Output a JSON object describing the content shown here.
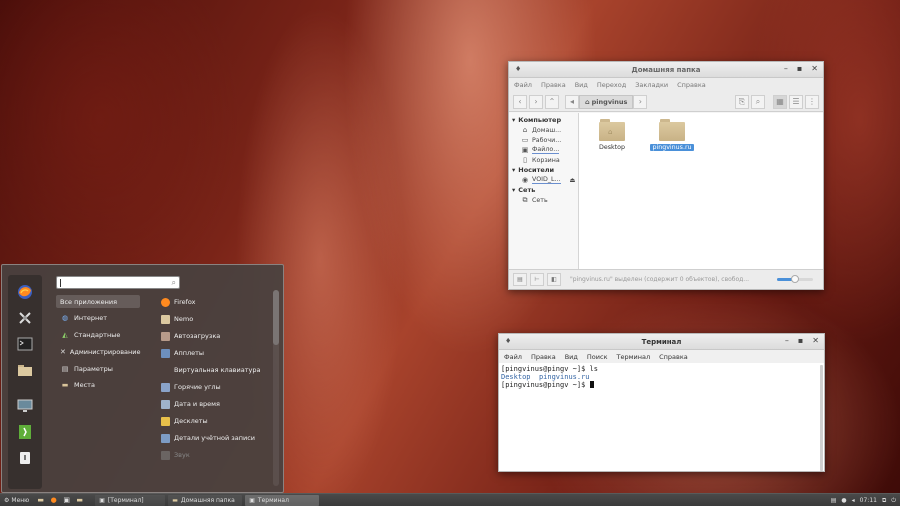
{
  "file_manager": {
    "title": "Домашняя папка",
    "menu": [
      "Файл",
      "Правка",
      "Вид",
      "Переход",
      "Закладки",
      "Справка"
    ],
    "path": "pingvinus",
    "sidebar": {
      "computer": {
        "header": "Компьютер",
        "items": [
          {
            "label": "Домаш...",
            "icon": "home-icon"
          },
          {
            "label": "Рабочи...",
            "icon": "desktop-icon"
          },
          {
            "label": "Файло...",
            "icon": "drive-icon"
          },
          {
            "label": "Корзина",
            "icon": "trash-icon"
          }
        ]
      },
      "devices": {
        "header": "Носители",
        "items": [
          {
            "label": "VOID_L...",
            "icon": "disc-icon"
          }
        ]
      },
      "network": {
        "header": "Сеть",
        "items": [
          {
            "label": "Сеть",
            "icon": "network-icon"
          }
        ]
      }
    },
    "files": [
      {
        "name": "Desktop",
        "selected": false
      },
      {
        "name": "pingvinus.ru",
        "selected": true
      }
    ],
    "status": "\"pingvinus.ru\" выделен (содержит 0 объектов), свобод...",
    "zoom_level": 0.5
  },
  "terminal": {
    "title": "Терминал",
    "menu": [
      "Файл",
      "Правка",
      "Вид",
      "Поиск",
      "Терминал",
      "Справка"
    ],
    "lines": {
      "l1": "[pingvinus@pingv ~]$ ls",
      "ls1": "Desktop",
      "ls2": "pingvinus.ru",
      "l3": "[pingvinus@pingv ~]$ "
    }
  },
  "menu": {
    "favorites": [
      "firefox-icon",
      "settings-icon",
      "terminal-icon",
      "folder-icon",
      "display-icon",
      "logout-icon",
      "shutdown-icon"
    ],
    "categories": [
      {
        "label": "Все приложения",
        "icon": "all-apps-icon",
        "active": true
      },
      {
        "label": "Интернет",
        "icon": "globe-icon",
        "active": false
      },
      {
        "label": "Стандартные",
        "icon": "accessories-icon",
        "active": false
      },
      {
        "label": "Администрирование",
        "icon": "admin-tools-icon",
        "active": false
      },
      {
        "label": "Параметры",
        "icon": "preferences-icon",
        "active": false
      },
      {
        "label": "Места",
        "icon": "places-icon",
        "active": false
      }
    ],
    "apps": [
      {
        "label": "Firefox",
        "icon": "firefox-icon"
      },
      {
        "label": "Nemo",
        "icon": "folder-icon"
      },
      {
        "label": "Автозагрузка",
        "icon": "startup-icon"
      },
      {
        "label": "Апплеты",
        "icon": "applets-icon"
      },
      {
        "label": "Виртуальная клавиатура",
        "icon": "keyboard-icon"
      },
      {
        "label": "Горячие углы",
        "icon": "hot-corners-icon"
      },
      {
        "label": "Дата и время",
        "icon": "clock-icon"
      },
      {
        "label": "Десклеты",
        "icon": "desklets-icon"
      },
      {
        "label": "Детали учётной записи",
        "icon": "account-icon"
      },
      {
        "label": "Звук",
        "icon": "sound-icon"
      }
    ]
  },
  "panel": {
    "menu_label": "Меню",
    "tasks": [
      {
        "label": "[Терминал]",
        "icon": "terminal-icon",
        "active": false
      },
      {
        "label": "Домашняя папка",
        "icon": "folder-icon",
        "active": false
      },
      {
        "label": "Терминал",
        "icon": "terminal-icon",
        "active": true
      }
    ],
    "clock": "07:11"
  }
}
